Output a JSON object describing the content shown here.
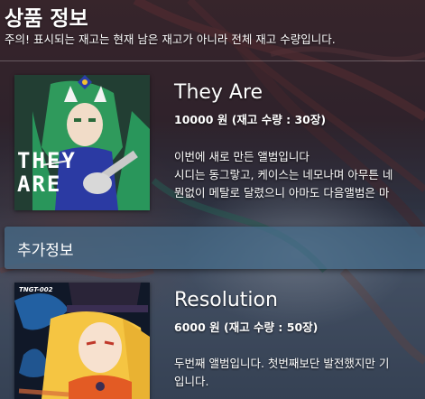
{
  "header": {
    "title": "상품 정보",
    "notice": "주의! 표시되는 재고는 현재 남은 재고가 아니라 전체 재고 수량입니다."
  },
  "albums": [
    {
      "title": "They Are",
      "price": "10000 원 (재고 수량 : 30장)",
      "description": [
        "이번에 새로 만든 앨범입니다",
        "시디는 동그랗고, 케이스는 네모나며 아무튼 네",
        "뭔없이 메탈로 달렸으니 아마도 다음앨범은 마"
      ],
      "cover_text": [
        "THEY",
        "ARE"
      ]
    },
    {
      "title": "Resolution",
      "price": "6000 원 (재고 수량 : 50장)",
      "description": [
        "두번째 앨범입니다. 첫번째보단 발전했지만 기",
        "입니다."
      ],
      "cover_text": [
        "TNGT-002"
      ]
    }
  ],
  "extra": {
    "label": "추가정보"
  }
}
